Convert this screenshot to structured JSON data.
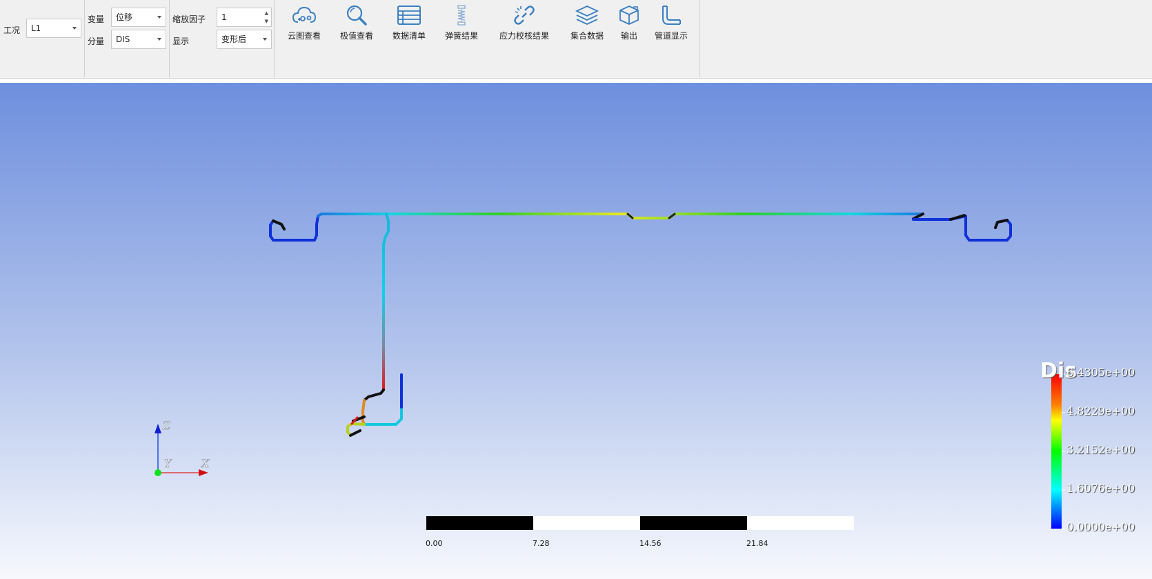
{
  "toolbar": {
    "case_label": "工况",
    "case_value": "L1",
    "variable_label": "变量",
    "variable_value": "位移",
    "component_label": "分量",
    "component_value": "DIS",
    "scale_label": "缩放因子",
    "scale_value": "1",
    "display_label": "显示",
    "display_value": "变形后",
    "tools": [
      {
        "label": "云图查看",
        "icon": "cloud-map-icon"
      },
      {
        "label": "极值查看",
        "icon": "magnifier-icon"
      },
      {
        "label": "数据清单",
        "icon": "list-icon"
      },
      {
        "label": "弹簧结果",
        "icon": "spring-icon"
      },
      {
        "label": "应力校核结果",
        "icon": "link-icon"
      },
      {
        "label": "集合数据",
        "icon": "layers-icon"
      },
      {
        "label": "输出",
        "icon": "export-box-icon"
      },
      {
        "label": "管道显示",
        "icon": "pipe-icon"
      }
    ]
  },
  "legend": {
    "title": "Dis",
    "values": [
      "6.4305e+00",
      "4.8229e+00",
      "3.2152e+00",
      "1.6076e+00",
      "0.0000e+00"
    ],
    "max": 6.4305,
    "min": 0.0
  },
  "scale_bar": {
    "ticks": [
      "0.00",
      "7.28",
      "14.56",
      "21.84"
    ]
  },
  "axes": {
    "z": "Z",
    "y": "Y",
    "x": "X"
  },
  "colors": {
    "toolbar_bg": "#f0f0f0",
    "icon_blue": "#3a7fc3",
    "viewport_top": "#6e8fde",
    "viewport_bottom": "#f6f8fd"
  }
}
